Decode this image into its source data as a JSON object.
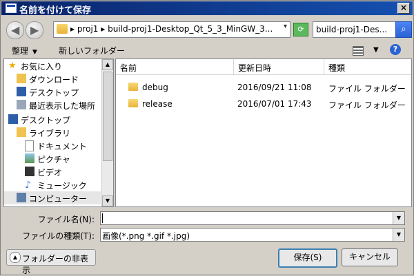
{
  "window": {
    "title": "名前を付けて保存",
    "close": "×"
  },
  "nav": {
    "address": "▸ proj1 ▸ build-proj1-Desktop_Qt_5_3_MinGW_3...",
    "address_dropdown": "▾",
    "refresh": "⟳",
    "search_value": "build-proj1-Des...",
    "search_icon": "⌕"
  },
  "toolbar": {
    "organize": "整理",
    "new_folder": "新しいフォルダー"
  },
  "tree": [
    {
      "label": "お気に入り",
      "icon": "star-icon"
    },
    {
      "label": "ダウンロード",
      "icon": "download-folder-icon"
    },
    {
      "label": "デスクトップ",
      "icon": "desktop-icon"
    },
    {
      "label": "最近表示した場所",
      "icon": "recent-places-icon"
    },
    {
      "label": "デスクトップ",
      "icon": "desktop-icon"
    },
    {
      "label": "ライブラリ",
      "icon": "library-icon"
    },
    {
      "label": "ドキュメント",
      "icon": "documents-icon"
    },
    {
      "label": "ピクチャ",
      "icon": "pictures-icon"
    },
    {
      "label": "ビデオ",
      "icon": "videos-icon"
    },
    {
      "label": "ミュージック",
      "icon": "music-icon"
    },
    {
      "label": "コンピューター",
      "icon": "computer-icon"
    }
  ],
  "columns": {
    "name": "名前",
    "date": "更新日時",
    "type": "種類"
  },
  "files": [
    {
      "name": "debug",
      "date": "2016/09/21 11:08",
      "type": "ファイル フォルダー"
    },
    {
      "name": "release",
      "date": "2016/07/01 17:43",
      "type": "ファイル フォルダー"
    }
  ],
  "form": {
    "filename_label": "ファイル名(N):",
    "filename_value": "",
    "filetype_label": "ファイルの種類(T):",
    "filetype_value": "画像(*.png *.gif *.jpg)"
  },
  "buttons": {
    "hide_folders": "フォルダーの非表示",
    "save": "保存(S)",
    "cancel": "キャンセル"
  }
}
